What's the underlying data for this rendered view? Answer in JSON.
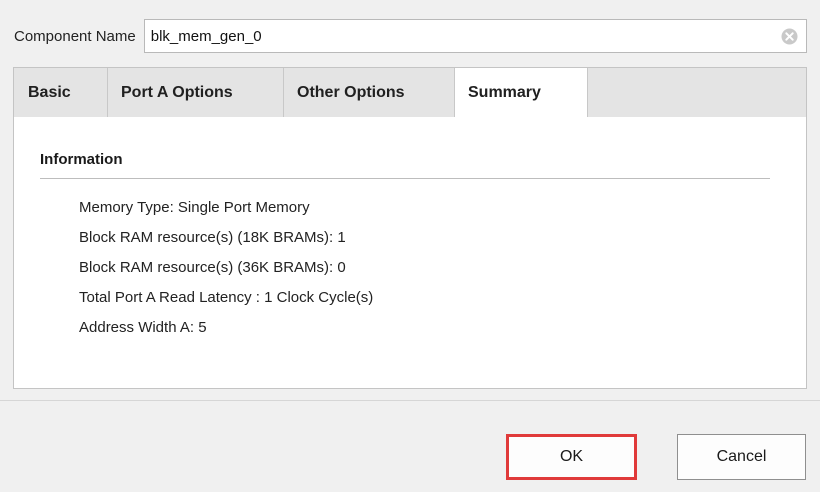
{
  "component": {
    "label": "Component Name",
    "value": "blk_mem_gen_0"
  },
  "tabs": [
    {
      "label": "Basic"
    },
    {
      "label": "Port A Options"
    },
    {
      "label": "Other Options"
    },
    {
      "label": "Summary",
      "selected": true
    }
  ],
  "summary": {
    "section_title": "Information",
    "items": [
      "Memory Type: Single Port Memory",
      "Block RAM resource(s) (18K BRAMs): 1",
      "Block RAM resource(s) (36K BRAMs): 0",
      "Total Port A Read Latency : 1 Clock Cycle(s)",
      "Address Width A: 5"
    ]
  },
  "buttons": {
    "ok_label": "OK",
    "cancel_label": "Cancel"
  },
  "icons": {
    "clear": "clear-icon"
  },
  "colors": {
    "highlight": "#e03a3a"
  }
}
